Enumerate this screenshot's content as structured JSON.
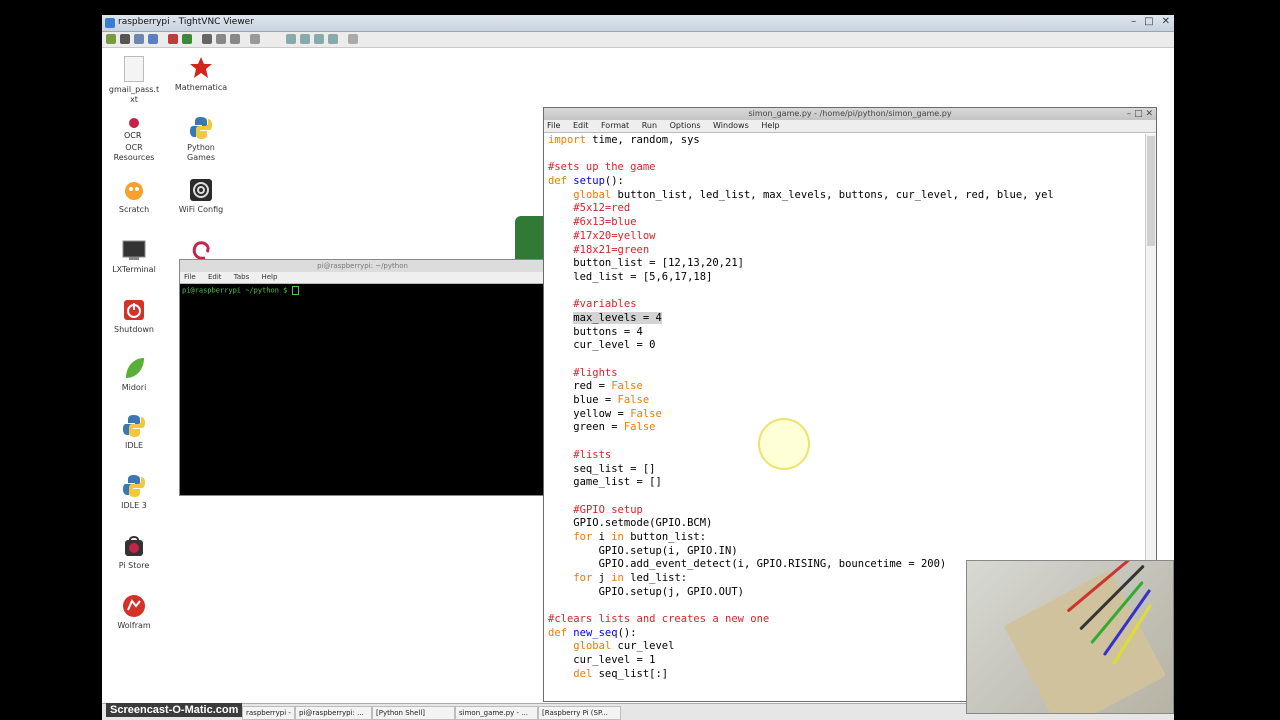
{
  "vnc": {
    "title": "raspberrypi - TightVNC Viewer"
  },
  "desktop_icons": [
    {
      "label": "gmail_pass.t\nxt",
      "icon": "text-file-icon"
    },
    {
      "label": "Mathematica",
      "icon": "mathematica-icon"
    },
    {
      "label": "OCR\nResources",
      "icon": "ocr-icon"
    },
    {
      "label": "Python\nGames",
      "icon": "python-icon"
    },
    {
      "label": "Scratch",
      "icon": "scratch-icon"
    },
    {
      "label": "WiFi Config",
      "icon": "wifi-icon"
    },
    {
      "label": "LXTerminal",
      "icon": "terminal-icon"
    },
    {
      "label": "Shutdown",
      "icon": "shutdown-icon"
    },
    {
      "label": "Midori",
      "icon": "midori-icon"
    },
    {
      "label": "IDLE",
      "icon": "python-icon"
    },
    {
      "label": "IDLE 3",
      "icon": "python-icon"
    },
    {
      "label": "Pi Store",
      "icon": "pistore-icon"
    },
    {
      "label": "Wolfram",
      "icon": "wolfram-icon"
    }
  ],
  "terminal": {
    "title": "pi@raspberrypi: ~/python",
    "menu": [
      "File",
      "Edit",
      "Tabs",
      "Help"
    ],
    "prompt": "pi@raspberrypi ~/python $ "
  },
  "editor": {
    "title": "simon_game.py - /home/pi/python/simon_game.py",
    "menu": [
      "File",
      "Edit",
      "Format",
      "Run",
      "Options",
      "Windows",
      "Help"
    ],
    "code_lines": [
      [
        [
          "kw",
          "import"
        ],
        [
          "n",
          " time, random, sys"
        ]
      ],
      [
        [
          "n",
          ""
        ]
      ],
      [
        [
          "cm",
          "#sets up the game"
        ]
      ],
      [
        [
          "kw",
          "def"
        ],
        [
          "n",
          " "
        ],
        [
          "fn",
          "setup"
        ],
        [
          "n",
          "():"
        ]
      ],
      [
        [
          "n",
          "    "
        ],
        [
          "kw",
          "global"
        ],
        [
          "n",
          " button_list, led_list, max_levels, buttons, cur_level, red, blue, yel"
        ]
      ],
      [
        [
          "n",
          "    "
        ],
        [
          "cm",
          "#5x12=red"
        ]
      ],
      [
        [
          "n",
          "    "
        ],
        [
          "cm",
          "#6x13=blue"
        ]
      ],
      [
        [
          "n",
          "    "
        ],
        [
          "cm",
          "#17x20=yellow"
        ]
      ],
      [
        [
          "n",
          "    "
        ],
        [
          "cm",
          "#18x21=green"
        ]
      ],
      [
        [
          "n",
          "    button_list = [12,13,20,21]"
        ]
      ],
      [
        [
          "n",
          "    led_list = [5,6,17,18]"
        ]
      ],
      [
        [
          "n",
          ""
        ]
      ],
      [
        [
          "n",
          "    "
        ],
        [
          "cm",
          "#variables"
        ]
      ],
      [
        [
          "n",
          "    "
        ],
        [
          "hl",
          "max_levels = 4"
        ]
      ],
      [
        [
          "n",
          "    buttons = 4"
        ]
      ],
      [
        [
          "n",
          "    cur_level = 0"
        ]
      ],
      [
        [
          "n",
          ""
        ]
      ],
      [
        [
          "n",
          "    "
        ],
        [
          "cm",
          "#lights"
        ]
      ],
      [
        [
          "n",
          "    red = "
        ],
        [
          "kw",
          "False"
        ]
      ],
      [
        [
          "n",
          "    blue = "
        ],
        [
          "kw",
          "False"
        ]
      ],
      [
        [
          "n",
          "    yellow = "
        ],
        [
          "kw",
          "False"
        ]
      ],
      [
        [
          "n",
          "    green = "
        ],
        [
          "kw",
          "False"
        ]
      ],
      [
        [
          "n",
          ""
        ]
      ],
      [
        [
          "n",
          "    "
        ],
        [
          "cm",
          "#lists"
        ]
      ],
      [
        [
          "n",
          "    seq_list = []"
        ]
      ],
      [
        [
          "n",
          "    game_list = []"
        ]
      ],
      [
        [
          "n",
          ""
        ]
      ],
      [
        [
          "n",
          "    "
        ],
        [
          "cm",
          "#GPIO setup"
        ]
      ],
      [
        [
          "n",
          "    GPIO.setmode(GPIO.BCM)"
        ]
      ],
      [
        [
          "n",
          "    "
        ],
        [
          "kw",
          "for"
        ],
        [
          "n",
          " i "
        ],
        [
          "kw",
          "in"
        ],
        [
          "n",
          " button_list:"
        ]
      ],
      [
        [
          "n",
          "        GPIO.setup(i, GPIO.IN)"
        ]
      ],
      [
        [
          "n",
          "        GPIO.add_event_detect(i, GPIO.RISING, bouncetime = 200)"
        ]
      ],
      [
        [
          "n",
          "    "
        ],
        [
          "kw",
          "for"
        ],
        [
          "n",
          " j "
        ],
        [
          "kw",
          "in"
        ],
        [
          "n",
          " led_list:"
        ]
      ],
      [
        [
          "n",
          "        GPIO.setup(j, GPIO.OUT)"
        ]
      ],
      [
        [
          "n",
          ""
        ]
      ],
      [
        [
          "cm",
          "#clears lists and creates a new one"
        ]
      ],
      [
        [
          "kw",
          "def"
        ],
        [
          "n",
          " "
        ],
        [
          "fn",
          "new_seq"
        ],
        [
          "n",
          "():"
        ]
      ],
      [
        [
          "n",
          "    "
        ],
        [
          "kw",
          "global"
        ],
        [
          "n",
          " cur_level"
        ]
      ],
      [
        [
          "n",
          "    cur_level = 1"
        ]
      ],
      [
        [
          "n",
          "    "
        ],
        [
          "kw",
          "del"
        ],
        [
          "n",
          " seq_list[:]"
        ]
      ]
    ]
  },
  "taskbar": {
    "items": [
      "raspberrypi - ...",
      "pi@raspberrypi: ...",
      "[Python Shell]",
      "simon_game.py - ...",
      "[Raspberry Pi (SP..."
    ]
  },
  "watermark": "Screencast-O-Matic.com",
  "colors": {
    "keyword": "#f07a00",
    "comment": "#d8232a",
    "function": "#0000dd",
    "terminal_prompt": "#4ec64e"
  }
}
